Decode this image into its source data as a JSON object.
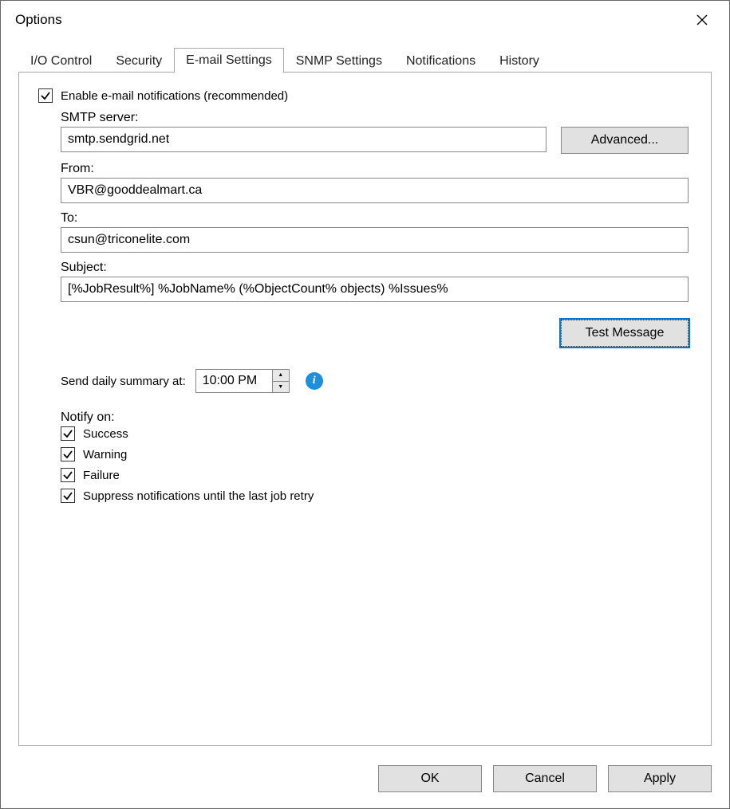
{
  "window": {
    "title": "Options"
  },
  "tabs": {
    "io": "I/O Control",
    "security": "Security",
    "email": "E-mail Settings",
    "snmp": "SNMP Settings",
    "notifications": "Notifications",
    "history": "History"
  },
  "email": {
    "enable_label": "Enable e-mail notifications (recommended)",
    "smtp_label": "SMTP server:",
    "smtp_value": "smtp.sendgrid.net",
    "advanced_btn": "Advanced...",
    "from_label": "From:",
    "from_value": "VBR@gooddealmart.ca",
    "to_label": "To:",
    "to_value": "csun@triconelite.com",
    "subject_label": "Subject:",
    "subject_value": "[%JobResult%] %JobName% (%ObjectCount% objects) %Issues%",
    "test_btn": "Test Message",
    "summary_label": "Send daily summary at:",
    "summary_time": "10:00 PM",
    "notify_label": "Notify on:",
    "notify_success": "Success",
    "notify_warning": "Warning",
    "notify_failure": "Failure",
    "notify_suppress": "Suppress notifications until the last job retry"
  },
  "footer": {
    "ok": "OK",
    "cancel": "Cancel",
    "apply": "Apply"
  }
}
